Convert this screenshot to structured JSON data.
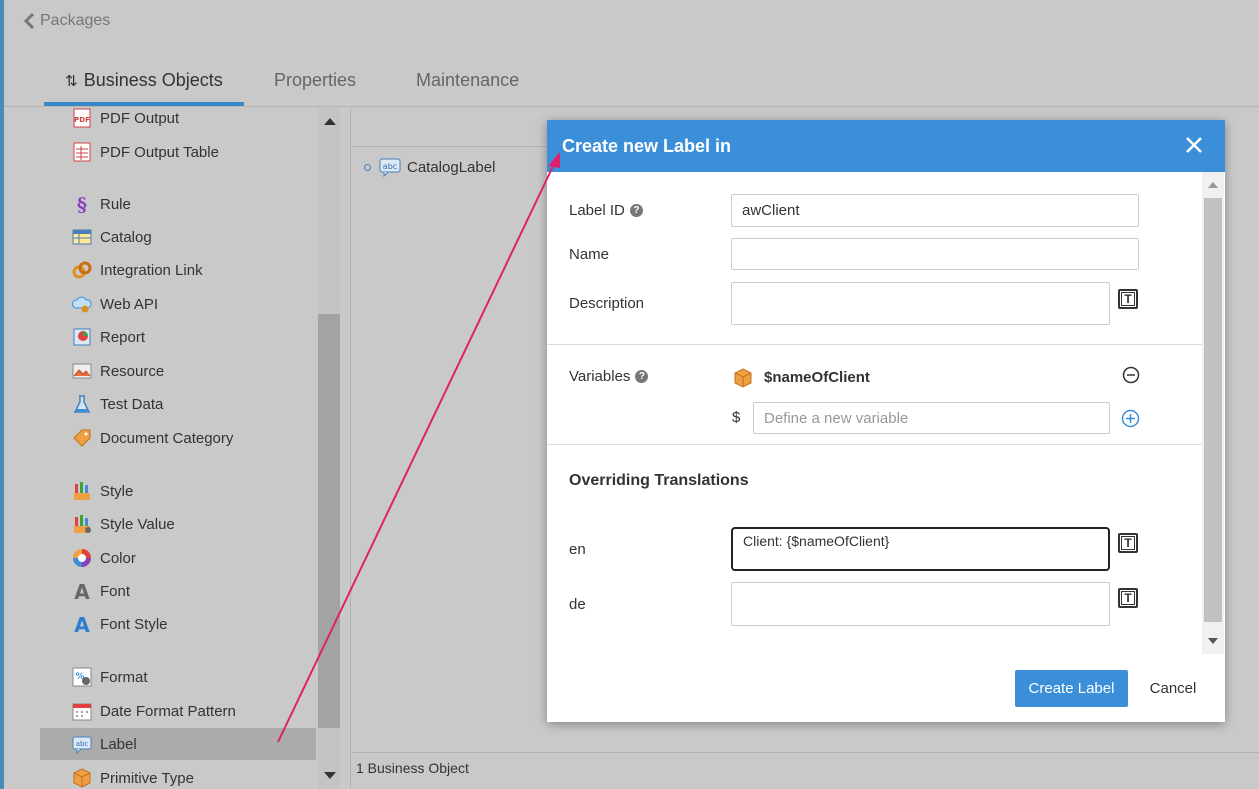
{
  "header": {
    "back_label": "Packages",
    "tabs": [
      {
        "label": "Business Objects",
        "active": true
      },
      {
        "label": "Properties",
        "active": false
      },
      {
        "label": "Maintenance",
        "active": false
      }
    ]
  },
  "sidebar": {
    "items": [
      {
        "label": "PDF Output",
        "icon": "pdf-icon"
      },
      {
        "label": "PDF Output Table",
        "icon": "pdf-table-icon"
      },
      {
        "label": "Rule",
        "icon": "rule-icon"
      },
      {
        "label": "Catalog",
        "icon": "catalog-icon"
      },
      {
        "label": "Integration Link",
        "icon": "integration-link-icon"
      },
      {
        "label": "Web API",
        "icon": "web-api-icon"
      },
      {
        "label": "Report",
        "icon": "report-icon"
      },
      {
        "label": "Resource",
        "icon": "resource-icon"
      },
      {
        "label": "Test Data",
        "icon": "test-data-icon"
      },
      {
        "label": "Document Category",
        "icon": "document-category-icon"
      },
      {
        "label": "Style",
        "icon": "style-icon"
      },
      {
        "label": "Style Value",
        "icon": "style-value-icon"
      },
      {
        "label": "Color",
        "icon": "color-icon"
      },
      {
        "label": "Font",
        "icon": "font-icon"
      },
      {
        "label": "Font Style",
        "icon": "font-style-icon"
      },
      {
        "label": "Format",
        "icon": "format-icon"
      },
      {
        "label": "Date Format Pattern",
        "icon": "date-format-icon"
      },
      {
        "label": "Label",
        "icon": "label-icon",
        "selected": true
      },
      {
        "label": "Primitive Type",
        "icon": "primitive-type-icon"
      }
    ]
  },
  "content": {
    "tree_item": "CatalogLabel",
    "footer": "1 Business Object"
  },
  "dialog": {
    "title": "Create new Label in",
    "fields": {
      "label_id": {
        "label": "Label ID",
        "value": "awClient"
      },
      "name": {
        "label": "Name",
        "value": ""
      },
      "description": {
        "label": "Description",
        "value": ""
      }
    },
    "variables": {
      "label": "Variables",
      "items": [
        "$nameOfClient"
      ],
      "prefix": "$",
      "new_placeholder": "Define a new variable"
    },
    "translations": {
      "title": "Overriding Translations",
      "rows": [
        {
          "lang": "en",
          "value": "Client: {$nameOfClient}"
        },
        {
          "lang": "de",
          "value": ""
        }
      ]
    },
    "buttons": {
      "create": "Create Label",
      "cancel": "Cancel"
    }
  },
  "colors": {
    "accent": "#3b8fd9",
    "annotation_arrow": "#e0206a"
  }
}
